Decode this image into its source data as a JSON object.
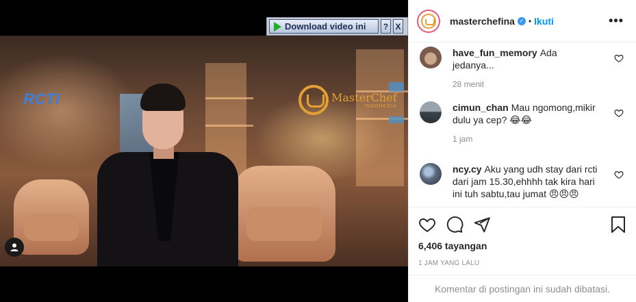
{
  "video": {
    "channel_logo": "RCTI",
    "show_logo_title": "MasterChef",
    "show_logo_subtitle": "INDONESIA",
    "download_label": "Download video ini",
    "help_label": "?",
    "close_label": "X",
    "profile_icon": "user-icon"
  },
  "post": {
    "username": "masterchefina",
    "verified_icon": "verified-check-icon",
    "separator": "•",
    "follow_label": "Ikuti",
    "more_label": "•••"
  },
  "comments": [
    {
      "user": "have_fun_memory",
      "text": "Ada jedanya...",
      "time": "28 menit",
      "avatar_color": "#7a5a4a"
    },
    {
      "user": "cimun_chan",
      "text": "Mau ngomong,mikir dulu ya cep? 😂😂",
      "time": "1 jam",
      "avatar_color": "#4a5560"
    },
    {
      "user": "ncy.cy",
      "text": "Aku yang udh stay dari rcti dari jam 15.30,ehhhh tak kira hari ini tuh sabtu,tau jumat 😠😠😠",
      "time": "",
      "avatar_color": "#5d6b80"
    }
  ],
  "actions": {
    "like_icon": "heart-icon",
    "comment_icon": "comment-icon",
    "share_icon": "paper-plane-icon",
    "save_icon": "bookmark-icon"
  },
  "stats": {
    "views": "6,406 tayangan",
    "posted": "1 JAM YANG LALU",
    "comments_closed": "Komentar di postingan ini sudah dibatasi."
  },
  "colors": {
    "follow_blue": "#0095f6",
    "verified_blue": "#3897f0",
    "muted_gray": "#8e8e8e",
    "mc_gold": "#e3a035",
    "rcti_blue": "#3d7fe0"
  }
}
